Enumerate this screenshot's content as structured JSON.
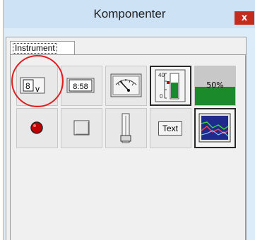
{
  "window": {
    "title": "Komponenter",
    "close_glyph": "x"
  },
  "tabs": [
    {
      "label": "Instrument",
      "active": true
    }
  ],
  "components": [
    {
      "row": 1,
      "name": "numeric-indicator",
      "glyph": "8",
      "unit": "v",
      "selected": false,
      "highlighted": true
    },
    {
      "row": 1,
      "name": "time-display",
      "glyph": "8:58",
      "selected": false
    },
    {
      "row": 1,
      "name": "analog-meter",
      "icon": "needle-gauge-icon",
      "selected": false
    },
    {
      "row": 1,
      "name": "bar-gauge",
      "icon": "vertical-bar-gauge-icon",
      "scale_top": "40",
      "scale_bottom": "0",
      "selected": true
    },
    {
      "row": 1,
      "name": "tank-level",
      "label": "50%",
      "level": 0.5,
      "selected": false
    },
    {
      "row": 2,
      "name": "led-indicator",
      "icon": "red-led-icon",
      "selected": false
    },
    {
      "row": 2,
      "name": "push-button",
      "icon": "square-button-icon",
      "selected": false
    },
    {
      "row": 2,
      "name": "slider",
      "icon": "vertical-slider-icon",
      "selected": false
    },
    {
      "row": 2,
      "name": "text-label",
      "label": "Text",
      "selected": false
    },
    {
      "row": 2,
      "name": "trend-graph",
      "icon": "trend-chart-icon",
      "selected": true
    }
  ],
  "colors": {
    "highlight_ring": "#e01f1f",
    "led": "#c00000",
    "gauge_green": "#1a8a2a",
    "close_button": "#c42b1c",
    "titlebar": "#cde3f5"
  }
}
